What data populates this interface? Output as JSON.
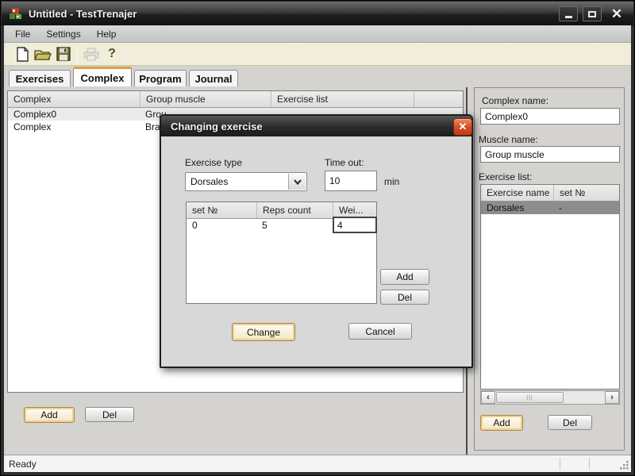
{
  "window": {
    "title": "Untitled - TestTrenajer"
  },
  "menu": {
    "items": [
      "File",
      "Settings",
      "Help"
    ]
  },
  "toolbar": {
    "icons": [
      "new-file",
      "open-folder",
      "save",
      "print",
      "help"
    ]
  },
  "tabs": [
    {
      "label": "Exercises",
      "active": false
    },
    {
      "label": "Complex",
      "active": true
    },
    {
      "label": "Program",
      "active": false
    },
    {
      "label": "Journal",
      "active": false
    }
  ],
  "left_table": {
    "columns": [
      "Complex",
      "Group muscle",
      "Exercise list"
    ],
    "rows": [
      [
        "Complex0",
        "Grou",
        ""
      ],
      [
        "Complex",
        "Braz",
        ""
      ]
    ]
  },
  "left_actions": {
    "add": "Add",
    "del": "Del"
  },
  "right_panel": {
    "complex_name_label": "Complex name:",
    "complex_name_value": "Complex0",
    "muscle_name_label": "Muscle name:",
    "muscle_name_value": "Group muscle",
    "exercise_list_label": "Exercise list:",
    "table": {
      "columns": [
        "Exercise name",
        "set №"
      ],
      "rows": [
        [
          "Dorsales",
          "-"
        ]
      ]
    },
    "add": "Add",
    "del": "Del"
  },
  "dialog": {
    "title": "Changing exercise",
    "exercise_type_label": "Exercise type",
    "exercise_type_value": "Dorsales",
    "time_out_label": "Time out:",
    "time_out_value": "10",
    "time_out_unit": "min",
    "table": {
      "columns": [
        "set №",
        "Reps count",
        "Wei..."
      ],
      "rows": [
        [
          "0",
          "5",
          "4"
        ]
      ]
    },
    "buttons": {
      "add": "Add",
      "del": "Del",
      "change": "Change",
      "cancel": "Cancel"
    }
  },
  "status_bar": {
    "text": "Ready"
  },
  "colors": {
    "tab_accent": "#e39b3c",
    "close_button": "#d44a22",
    "focus_gold": "#ecd193",
    "selection_gray": "#8d8d8d"
  }
}
